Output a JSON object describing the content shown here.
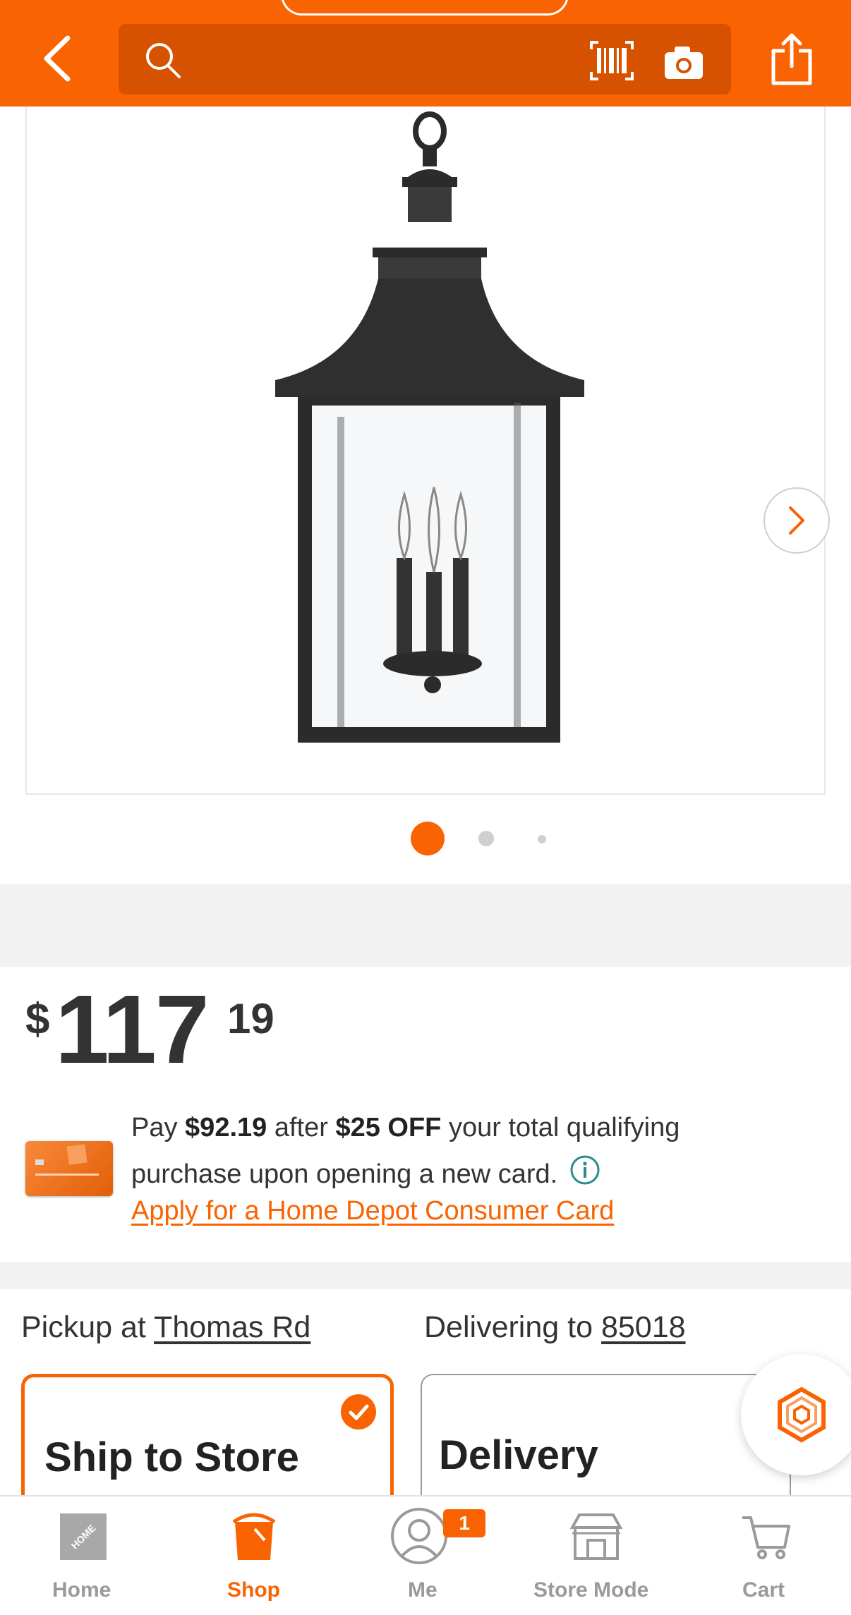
{
  "header": {
    "search_placeholder": "",
    "icons": [
      "back-arrow-icon",
      "search-icon",
      "barcode-icon",
      "camera-icon",
      "share-icon"
    ]
  },
  "gallery": {
    "image_alt": "outdoor-lantern-pendant",
    "active_dot": 1,
    "dot_count": 3
  },
  "price": {
    "currency": "$",
    "dollars": "117",
    "cents": "19"
  },
  "promo": {
    "pay_prefix": "Pay",
    "pay_amount": "$92.19",
    "after_word": "after",
    "discount": "$25 OFF",
    "rest": "your total qualifying purchase upon opening a new card.",
    "apply_link": "Apply for a Home Depot Consumer Card"
  },
  "fulfillment": {
    "pickup_prefix": "Pickup at",
    "pickup_store": "Thomas Rd",
    "delivery_prefix": "Delivering to",
    "delivery_zip": "85018",
    "ship_to_store": "Ship to Store",
    "delivery": "Delivery",
    "selected": "Ship to Store"
  },
  "nav": {
    "home": "Home",
    "shop": "Shop",
    "me": "Me",
    "me_badge": "1",
    "store_mode": "Store Mode",
    "cart": "Cart",
    "active": "Shop"
  },
  "colors": {
    "brand_orange": "#f96302",
    "search_bg": "#d65200",
    "muted_gray": "#9a9a9a"
  }
}
